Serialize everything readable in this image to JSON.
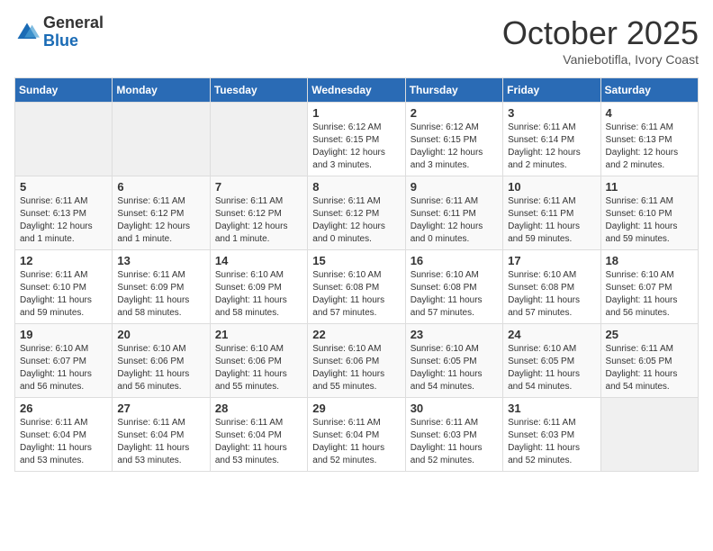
{
  "header": {
    "logo_line1": "General",
    "logo_line2": "Blue",
    "month": "October 2025",
    "location": "Vaniebotifla, Ivory Coast"
  },
  "days_of_week": [
    "Sunday",
    "Monday",
    "Tuesday",
    "Wednesday",
    "Thursday",
    "Friday",
    "Saturday"
  ],
  "weeks": [
    [
      {
        "num": "",
        "info": ""
      },
      {
        "num": "",
        "info": ""
      },
      {
        "num": "",
        "info": ""
      },
      {
        "num": "1",
        "info": "Sunrise: 6:12 AM\nSunset: 6:15 PM\nDaylight: 12 hours\nand 3 minutes."
      },
      {
        "num": "2",
        "info": "Sunrise: 6:12 AM\nSunset: 6:15 PM\nDaylight: 12 hours\nand 3 minutes."
      },
      {
        "num": "3",
        "info": "Sunrise: 6:11 AM\nSunset: 6:14 PM\nDaylight: 12 hours\nand 2 minutes."
      },
      {
        "num": "4",
        "info": "Sunrise: 6:11 AM\nSunset: 6:13 PM\nDaylight: 12 hours\nand 2 minutes."
      }
    ],
    [
      {
        "num": "5",
        "info": "Sunrise: 6:11 AM\nSunset: 6:13 PM\nDaylight: 12 hours\nand 1 minute."
      },
      {
        "num": "6",
        "info": "Sunrise: 6:11 AM\nSunset: 6:12 PM\nDaylight: 12 hours\nand 1 minute."
      },
      {
        "num": "7",
        "info": "Sunrise: 6:11 AM\nSunset: 6:12 PM\nDaylight: 12 hours\nand 1 minute."
      },
      {
        "num": "8",
        "info": "Sunrise: 6:11 AM\nSunset: 6:12 PM\nDaylight: 12 hours\nand 0 minutes."
      },
      {
        "num": "9",
        "info": "Sunrise: 6:11 AM\nSunset: 6:11 PM\nDaylight: 12 hours\nand 0 minutes."
      },
      {
        "num": "10",
        "info": "Sunrise: 6:11 AM\nSunset: 6:11 PM\nDaylight: 11 hours\nand 59 minutes."
      },
      {
        "num": "11",
        "info": "Sunrise: 6:11 AM\nSunset: 6:10 PM\nDaylight: 11 hours\nand 59 minutes."
      }
    ],
    [
      {
        "num": "12",
        "info": "Sunrise: 6:11 AM\nSunset: 6:10 PM\nDaylight: 11 hours\nand 59 minutes."
      },
      {
        "num": "13",
        "info": "Sunrise: 6:11 AM\nSunset: 6:09 PM\nDaylight: 11 hours\nand 58 minutes."
      },
      {
        "num": "14",
        "info": "Sunrise: 6:10 AM\nSunset: 6:09 PM\nDaylight: 11 hours\nand 58 minutes."
      },
      {
        "num": "15",
        "info": "Sunrise: 6:10 AM\nSunset: 6:08 PM\nDaylight: 11 hours\nand 57 minutes."
      },
      {
        "num": "16",
        "info": "Sunrise: 6:10 AM\nSunset: 6:08 PM\nDaylight: 11 hours\nand 57 minutes."
      },
      {
        "num": "17",
        "info": "Sunrise: 6:10 AM\nSunset: 6:08 PM\nDaylight: 11 hours\nand 57 minutes."
      },
      {
        "num": "18",
        "info": "Sunrise: 6:10 AM\nSunset: 6:07 PM\nDaylight: 11 hours\nand 56 minutes."
      }
    ],
    [
      {
        "num": "19",
        "info": "Sunrise: 6:10 AM\nSunset: 6:07 PM\nDaylight: 11 hours\nand 56 minutes."
      },
      {
        "num": "20",
        "info": "Sunrise: 6:10 AM\nSunset: 6:06 PM\nDaylight: 11 hours\nand 56 minutes."
      },
      {
        "num": "21",
        "info": "Sunrise: 6:10 AM\nSunset: 6:06 PM\nDaylight: 11 hours\nand 55 minutes."
      },
      {
        "num": "22",
        "info": "Sunrise: 6:10 AM\nSunset: 6:06 PM\nDaylight: 11 hours\nand 55 minutes."
      },
      {
        "num": "23",
        "info": "Sunrise: 6:10 AM\nSunset: 6:05 PM\nDaylight: 11 hours\nand 54 minutes."
      },
      {
        "num": "24",
        "info": "Sunrise: 6:10 AM\nSunset: 6:05 PM\nDaylight: 11 hours\nand 54 minutes."
      },
      {
        "num": "25",
        "info": "Sunrise: 6:11 AM\nSunset: 6:05 PM\nDaylight: 11 hours\nand 54 minutes."
      }
    ],
    [
      {
        "num": "26",
        "info": "Sunrise: 6:11 AM\nSunset: 6:04 PM\nDaylight: 11 hours\nand 53 minutes."
      },
      {
        "num": "27",
        "info": "Sunrise: 6:11 AM\nSunset: 6:04 PM\nDaylight: 11 hours\nand 53 minutes."
      },
      {
        "num": "28",
        "info": "Sunrise: 6:11 AM\nSunset: 6:04 PM\nDaylight: 11 hours\nand 53 minutes."
      },
      {
        "num": "29",
        "info": "Sunrise: 6:11 AM\nSunset: 6:04 PM\nDaylight: 11 hours\nand 52 minutes."
      },
      {
        "num": "30",
        "info": "Sunrise: 6:11 AM\nSunset: 6:03 PM\nDaylight: 11 hours\nand 52 minutes."
      },
      {
        "num": "31",
        "info": "Sunrise: 6:11 AM\nSunset: 6:03 PM\nDaylight: 11 hours\nand 52 minutes."
      },
      {
        "num": "",
        "info": ""
      }
    ]
  ]
}
